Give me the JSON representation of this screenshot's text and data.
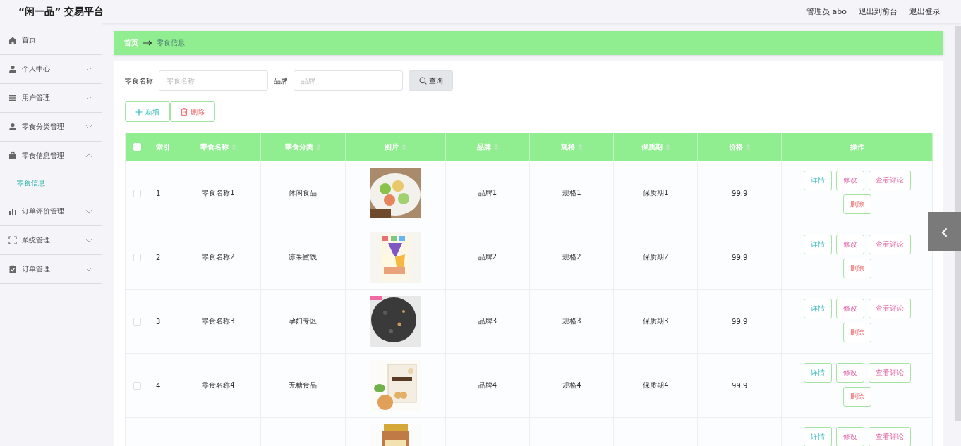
{
  "header": {
    "title": "“闲一品” 交易平台",
    "user": "管理员 abo",
    "links": [
      "退出到前台",
      "退出登录"
    ]
  },
  "sidebar": {
    "items": [
      {
        "kind": "home",
        "label": "首页"
      },
      {
        "kind": "person",
        "label": "个人中心",
        "expanded": false
      },
      {
        "kind": "list",
        "label": "用户管理",
        "expanded": false
      },
      {
        "kind": "person",
        "label": "零食分类管理",
        "expanded": false
      },
      {
        "kind": "briefcase",
        "label": "零食信息管理",
        "expanded": true,
        "children": [
          {
            "label": "零食信息",
            "selected": true
          }
        ]
      },
      {
        "kind": "chart",
        "label": "订单评价管理",
        "expanded": false
      },
      {
        "kind": "frame",
        "label": "系统管理",
        "expanded": false
      },
      {
        "kind": "clipboard",
        "label": "订单管理",
        "expanded": false
      }
    ]
  },
  "breadcrumb": [
    "首页",
    "零食信息"
  ],
  "search": {
    "fields": [
      {
        "label": "零食名称",
        "placeholder": "零食名称"
      },
      {
        "label": "品牌",
        "placeholder": "品牌"
      }
    ],
    "button": "查询"
  },
  "toolbar": [
    {
      "kind": "add",
      "label": "新增"
    },
    {
      "kind": "delete",
      "label": "删除"
    }
  ],
  "table": {
    "select_all": false,
    "columns": [
      {
        "label": "索引",
        "sortable": false
      },
      {
        "label": "零食名称",
        "sortable": true
      },
      {
        "label": "零食分类",
        "sortable": true
      },
      {
        "label": "图片",
        "sortable": true
      },
      {
        "label": "品牌",
        "sortable": true
      },
      {
        "label": "规格",
        "sortable": true
      },
      {
        "label": "保质期",
        "sortable": true
      },
      {
        "label": "价格",
        "sortable": true
      },
      {
        "label": "操作",
        "sortable": false
      }
    ],
    "rows": [
      {
        "checked": false,
        "cells": [
          "1",
          "零食名称1",
          "休闲食品",
          "品牌1",
          "规格1",
          "保质期1",
          "99.9"
        ],
        "actions": [
          "详情",
          "修改",
          "查看评论",
          "删除"
        ]
      },
      {
        "checked": false,
        "cells": [
          "2",
          "零食名称2",
          "凉果蜜饯",
          "品牌2",
          "规格2",
          "保质期2",
          "99.9"
        ],
        "actions": [
          "详情",
          "修改",
          "查看评论",
          "删除"
        ]
      },
      {
        "checked": false,
        "cells": [
          "3",
          "零食名称3",
          "孕妇专区",
          "品牌3",
          "规格3",
          "保质期3",
          "99.9"
        ],
        "actions": [
          "详情",
          "修改",
          "查看评论",
          "删除"
        ]
      },
      {
        "checked": false,
        "cells": [
          "4",
          "零食名称4",
          "无糖食品",
          "品牌4",
          "规格4",
          "保质期4",
          "99.9"
        ],
        "actions": [
          "详情",
          "修改",
          "查看评论",
          "删除"
        ]
      },
      {
        "actions": [
          "详情",
          "修改",
          "查看评论"
        ]
      }
    ]
  },
  "side_handle": "‹"
}
